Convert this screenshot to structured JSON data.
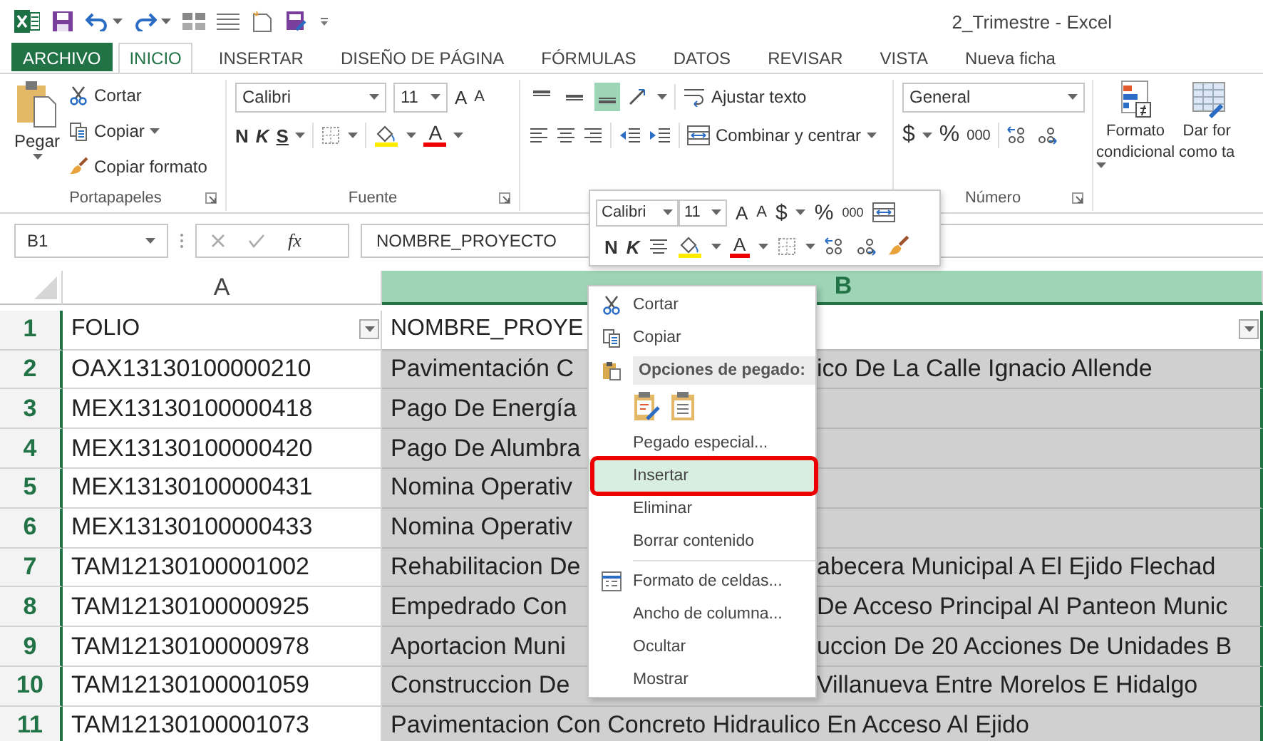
{
  "title_bar": {
    "title": "2_Trimestre - Excel"
  },
  "ribbon_tabs": [
    {
      "label": "ARCHIVO",
      "kind": "file",
      "selected": false
    },
    {
      "label": "INICIO",
      "kind": "tab",
      "selected": true
    },
    {
      "label": "INSERTAR",
      "kind": "tab",
      "selected": false
    },
    {
      "label": "DISEÑO DE PÁGINA",
      "kind": "tab",
      "selected": false
    },
    {
      "label": "FÓRMULAS",
      "kind": "tab",
      "selected": false
    },
    {
      "label": "DATOS",
      "kind": "tab",
      "selected": false
    },
    {
      "label": "REVISAR",
      "kind": "tab",
      "selected": false
    },
    {
      "label": "VISTA",
      "kind": "tab",
      "selected": false
    },
    {
      "label": "Nueva ficha",
      "kind": "tab",
      "selected": false
    }
  ],
  "clipboard_group": {
    "label": "Portapapeles",
    "paste": "Pegar",
    "cut": "Cortar",
    "copy": "Copiar",
    "format_painter": "Copiar formato"
  },
  "font_group": {
    "label": "Fuente",
    "font": "Calibri",
    "size": "11",
    "grow": "A",
    "shrink": "A",
    "bold": "N",
    "italic": "K",
    "underline": "S",
    "font_color": "A"
  },
  "alignment_group": {
    "vertical_align": [
      {
        "selected": false
      },
      {
        "selected": false
      },
      {
        "selected": true
      }
    ],
    "wrap_text": "Ajustar texto",
    "merge": "Combinar y centrar"
  },
  "number_group": {
    "label": "Número",
    "format": "General",
    "currency": "$",
    "percent": "%",
    "thousands": "000"
  },
  "styles_group": {
    "conditional_format": [
      "Formato",
      "condicional"
    ],
    "format_as_table": [
      "Dar for",
      "como ta"
    ]
  },
  "formula_bar": {
    "name_box": "B1",
    "function_label": "fx",
    "formula": "NOMBRE_PROYECTO"
  },
  "sheet": {
    "columns": [
      {
        "label": "A",
        "selected": false
      },
      {
        "label": "B",
        "selected": true
      }
    ],
    "rows": [
      {
        "number": "1",
        "kind": "header",
        "folio": "FOLIO",
        "project": "NOMBRE_PROYE"
      },
      {
        "number": "2",
        "kind": "data",
        "folio": "OAX13130100000210",
        "project": "Pavimentación C",
        "project_continued": "ico De La Calle Ignacio Allende"
      },
      {
        "number": "3",
        "kind": "data",
        "folio": "MEX13130100000418",
        "project": "Pago De Energía"
      },
      {
        "number": "4",
        "kind": "data",
        "folio": "MEX13130100000420",
        "project": "Pago De Alumbra"
      },
      {
        "number": "5",
        "kind": "data",
        "folio": "MEX13130100000431",
        "project": "Nomina Operativ"
      },
      {
        "number": "6",
        "kind": "data",
        "folio": "MEX13130100000433",
        "project": "Nomina Operativ"
      },
      {
        "number": "7",
        "kind": "data",
        "folio": "TAM12130100001002",
        "project": "Rehabilitacion De",
        "project_continued": "abecera Municipal A El Ejido Flechad"
      },
      {
        "number": "8",
        "kind": "data",
        "folio": "TAM12130100000925",
        "project": "Empedrado Con",
        "project_continued": "De Acceso Principal Al Panteon Munic"
      },
      {
        "number": "9",
        "kind": "data",
        "folio": "TAM12130100000978",
        "project": "Aportacion Muni",
        "project_continued": "uccion De 20 Acciones De Unidades B"
      },
      {
        "number": "10",
        "kind": "data",
        "folio": "TAM12130100001059",
        "project": "Construccion De",
        "project_continued": "Villanueva Entre Morelos E Hidalgo"
      },
      {
        "number": "11",
        "kind": "data",
        "folio": "TAM12130100001073",
        "project": "Pavimentacion Con Concreto Hidraulico En Acceso Al Ejido"
      }
    ]
  },
  "mini_toolbar": {
    "font": "Calibri",
    "size": "11",
    "grow": "A",
    "shrink": "A",
    "currency": "$",
    "percent": "%",
    "thousands": "000",
    "bold": "N",
    "italic": "K",
    "font_color": "A"
  },
  "context_menu": {
    "items": [
      {
        "kind": "cut",
        "label": "Cortar",
        "selected": false,
        "annotated": false
      },
      {
        "kind": "copy",
        "label": "Copiar",
        "selected": false,
        "annotated": false
      },
      {
        "kind": "header",
        "label": "Opciones de pegado:"
      },
      {
        "kind": "paste_options"
      },
      {
        "kind": "command",
        "label": "Pegado especial...",
        "selected": false,
        "annotated": false
      },
      {
        "kind": "command",
        "label": "Insertar",
        "selected": true,
        "annotated": true
      },
      {
        "kind": "command",
        "label": "Eliminar",
        "selected": false,
        "annotated": false
      },
      {
        "kind": "command",
        "label": "Borrar contenido",
        "selected": false,
        "annotated": false
      },
      {
        "kind": "separator"
      },
      {
        "kind": "format_cells",
        "label": "Formato de celdas...",
        "selected": false,
        "annotated": false
      },
      {
        "kind": "command",
        "label": "Ancho de columna...",
        "selected": false,
        "annotated": false
      },
      {
        "kind": "command",
        "label": "Ocultar",
        "selected": false,
        "annotated": false
      },
      {
        "kind": "command",
        "label": "Mostrar",
        "selected": false,
        "annotated": false
      }
    ]
  }
}
